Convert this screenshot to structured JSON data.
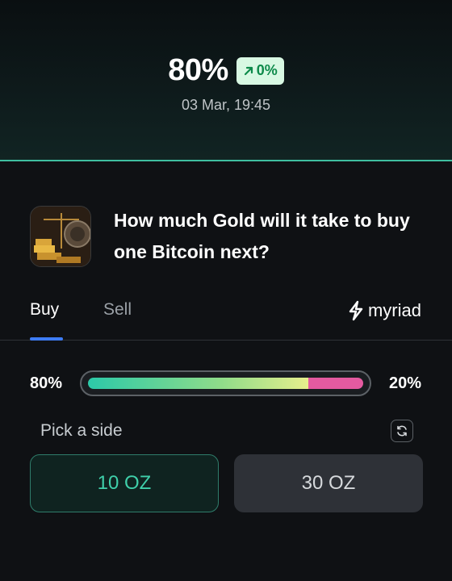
{
  "header": {
    "probability": "80%",
    "change": "0%",
    "change_icon": "arrow-up-right-icon",
    "timestamp": "03 Mar, 19:45"
  },
  "market": {
    "title": "How much Gold will it take to buy one Bitcoin next?",
    "thumbnail_icon": "gold-bitcoin-thumbnail"
  },
  "tabs": [
    {
      "label": "Buy",
      "active": true
    },
    {
      "label": "Sell",
      "active": false
    }
  ],
  "brand": {
    "name": "myriad",
    "icon": "myriad-logo-icon"
  },
  "probability_bar": {
    "left_label": "80%",
    "right_label": "20%",
    "left_fraction": 0.8
  },
  "pick": {
    "label": "Pick a side",
    "refresh_icon": "refresh-icon"
  },
  "options": [
    {
      "label": "10 OZ",
      "selected": true
    },
    {
      "label": "30 OZ",
      "selected": false
    }
  ],
  "colors": {
    "accent": "#3fbfa0",
    "tab_underline": "#3d7cf5",
    "no_bar": "#e45aa0",
    "badge_bg": "#d8f8e3",
    "badge_text": "#0d8a4a"
  }
}
